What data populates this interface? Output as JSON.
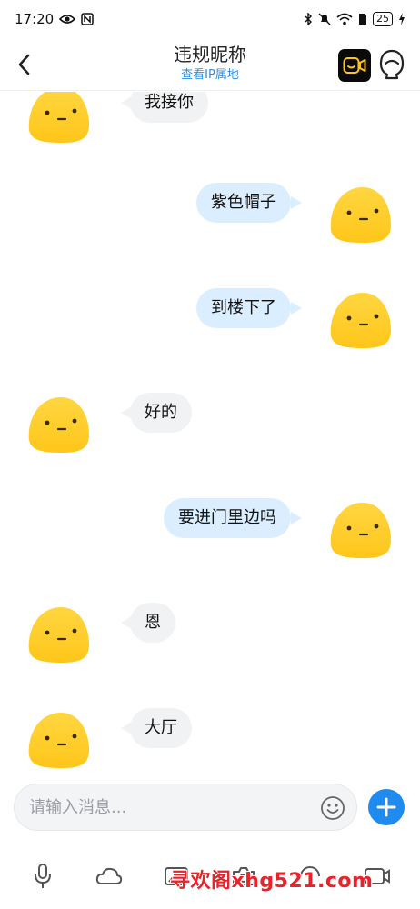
{
  "status_bar": {
    "time": "17:20",
    "battery": "25",
    "icons": [
      "eye-icon",
      "nfc-icon",
      "bluetooth-icon",
      "mute-icon",
      "wifi-icon",
      "sim-icon",
      "charging-icon"
    ]
  },
  "header": {
    "back_icon": "chevron-left-icon",
    "title": "违规昵称",
    "subtitle": "查看IP属地",
    "video_icon": "video-call-icon",
    "profile_icon": "profile-icon"
  },
  "messages": [
    {
      "side": "left",
      "text": "我接你"
    },
    {
      "side": "right",
      "text": "紫色帽子"
    },
    {
      "side": "right",
      "text": "到楼下了"
    },
    {
      "side": "left",
      "text": "好的"
    },
    {
      "side": "right",
      "text": "要进门里边吗"
    },
    {
      "side": "left",
      "text": "恩"
    },
    {
      "side": "left",
      "text": "大厅"
    }
  ],
  "input": {
    "placeholder": "请输入消息...",
    "value": "",
    "emoji_icon": "emoji-icon",
    "plus_icon": "plus-icon"
  },
  "toolbar": {
    "icons": [
      "microphone-icon",
      "cloud-icon",
      "image-icon",
      "camera-icon",
      "sticker-icon",
      "gif-icon"
    ]
  },
  "watermark": {
    "text": "寻欢阁xhg521.com"
  },
  "colors": {
    "accent": "#1f8bf0",
    "link": "#2f8fe0",
    "bubble_left": "#f1f2f4",
    "bubble_right": "#dbeeff",
    "avatar_yellow": "#ffc61a"
  }
}
